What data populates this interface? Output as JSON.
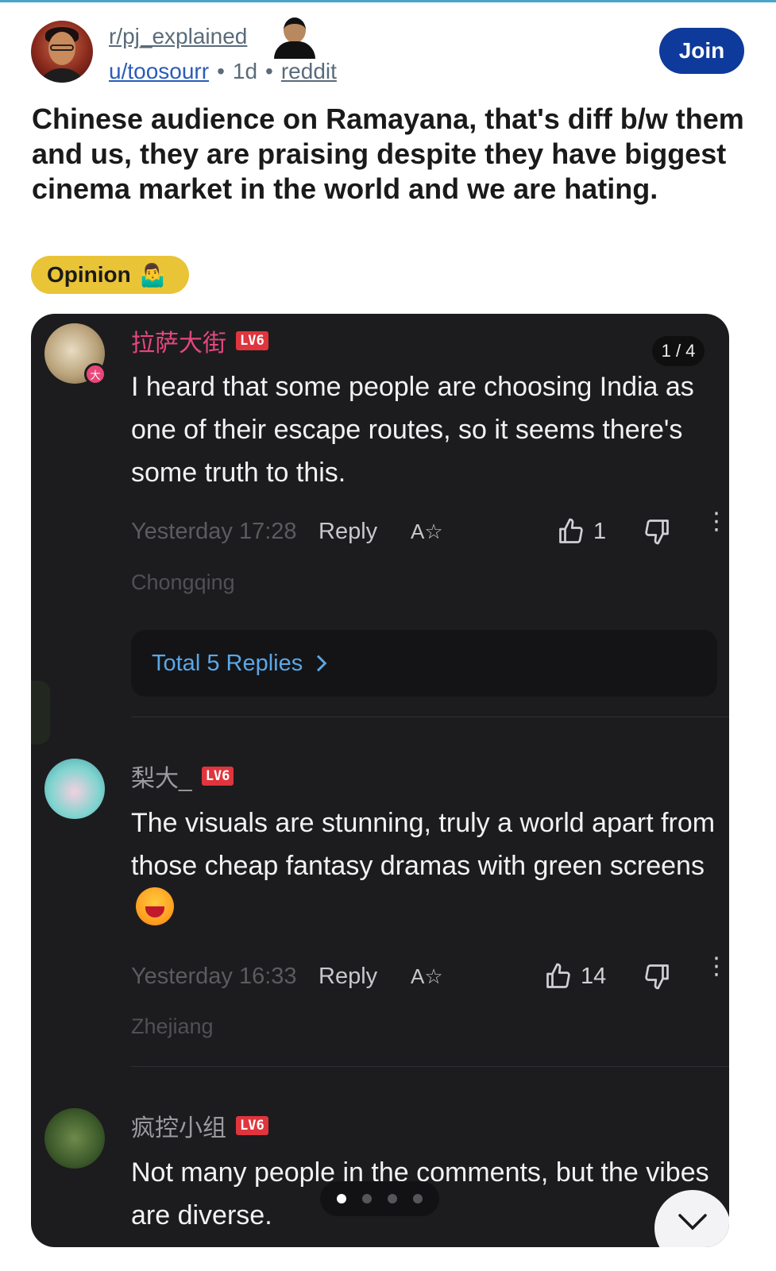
{
  "post": {
    "subreddit": "r/pj_explained",
    "user": "u/toosourr",
    "age": "1d",
    "source": "reddit",
    "join_label": "Join",
    "title": "Chinese audience on Ramayana, that's diff b/w them and us, they are praising despite they have biggest cinema market in the world and we are hating.",
    "flair": "Opinion",
    "flair_emoji": "🤷‍♂️"
  },
  "image": {
    "counter": "1 / 4",
    "comments": [
      {
        "username": "拉萨大街",
        "level": "LV6",
        "text": "I heard that some people are choosing India as one of their escape routes, so it seems there's some truth to this.",
        "time": "Yesterday 17:28",
        "reply": "Reply",
        "translate": "A☆",
        "likes": "1",
        "location": "Chongqing",
        "replies": "Total 5 Replies",
        "badge": "大"
      },
      {
        "username": "梨大_",
        "level": "LV6",
        "text": "The visuals are stunning, truly a world apart from those cheap fantasy dramas with green screens",
        "time": "Yesterday 16:33",
        "reply": "Reply",
        "translate": "A☆",
        "likes": "14",
        "location": "Zhejiang"
      },
      {
        "username": "疯控小组",
        "level": "LV6",
        "text": "Not many people in the comments, but the vibes are diverse."
      }
    ],
    "pager": {
      "total": 4,
      "current": 1
    }
  },
  "colors": {
    "join_bg": "#0e3a9b",
    "flair_bg": "#e9c437",
    "dark_bg": "#1c1c1e",
    "username_pink": "#e5477d",
    "level_red": "#e0353d",
    "replies_blue": "#5aa7e8"
  }
}
